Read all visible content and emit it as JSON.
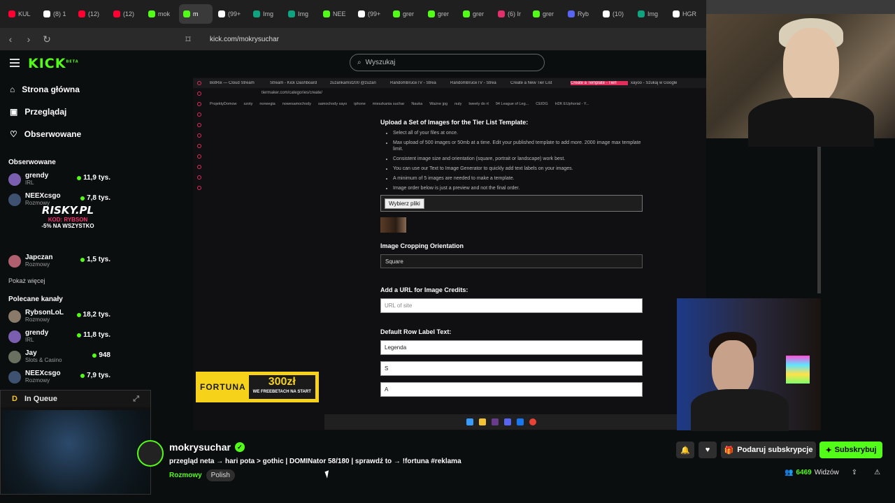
{
  "browser": {
    "tabs": [
      {
        "label": "KUL",
        "color": "#ff0033"
      },
      {
        "label": "(8) 1",
        "color": "#ffffff"
      },
      {
        "label": "(12)",
        "color": "#ff0033"
      },
      {
        "label": "(12)",
        "color": "#ff0033"
      },
      {
        "label": "mok",
        "color": "#53fc18"
      },
      {
        "label": "m",
        "color": "#53fc18",
        "active": true
      },
      {
        "label": "(99+",
        "color": "#ffffff"
      },
      {
        "label": "Img",
        "color": "#10a37f"
      },
      {
        "label": "Img",
        "color": "#10a37f"
      },
      {
        "label": "NEE",
        "color": "#53fc18"
      },
      {
        "label": "(99+",
        "color": "#ffffff"
      },
      {
        "label": "grer",
        "color": "#53fc18"
      },
      {
        "label": "grer",
        "color": "#53fc18"
      },
      {
        "label": "grer",
        "color": "#53fc18"
      },
      {
        "label": "(6) Ir",
        "color": "#e1306c"
      },
      {
        "label": "grer",
        "color": "#53fc18"
      },
      {
        "label": "Ryb",
        "color": "#5865f2"
      },
      {
        "label": "(10)",
        "color": "#ffffff"
      },
      {
        "label": "Img",
        "color": "#10a37f"
      },
      {
        "label": "HGR",
        "color": "#ffffff"
      }
    ],
    "url": "kick.com/mokrysuchar"
  },
  "header": {
    "logo": "KICK",
    "logo_beta": "BETA",
    "search_placeholder": "Wyszukaj"
  },
  "sidebar": {
    "nav": [
      {
        "label": "Strona główna",
        "icon": "home-icon"
      },
      {
        "label": "Przeglądaj",
        "icon": "browse-icon"
      },
      {
        "label": "Obserwowane",
        "icon": "heart-icon"
      }
    ],
    "following_title": "Obserwowane",
    "following": [
      {
        "name": "grendy",
        "category": "IRL",
        "viewers": "11,9 tys."
      },
      {
        "name": "NEEXcsgo",
        "category": "Rozmowy",
        "viewers": "7,8 tys."
      },
      {
        "name": "Japczan",
        "category": "Rozmowy",
        "viewers": "1,5 tys."
      }
    ],
    "show_more": "Pokaż więcej",
    "recommended_title": "Polecane kanały",
    "recommended": [
      {
        "name": "RybsonLoL",
        "category": "Rozmowy",
        "viewers": "18,2 tys."
      },
      {
        "name": "grendy",
        "category": "IRL",
        "viewers": "11,8 tys."
      },
      {
        "name": "Jay",
        "category": "Slots & Casino",
        "viewers": "948"
      },
      {
        "name": "NEEXcsgo",
        "category": "Rozmowy",
        "viewers": "7,9 tys."
      }
    ],
    "promo": {
      "brand": "RISKY.PL",
      "code": "KOD: RYBSON",
      "offer": "-5% NA WSZYSTKO"
    }
  },
  "stream": {
    "inner_tabs": [
      "BotRix — Cloud Stream",
      "Stream - Kick Dashboard",
      "zuzankamst200 @zuzan",
      "RandomBruceTV - Strea",
      "RandomBruceTV - Strea",
      "Create a New Tier List",
      "Create a Template - Tierl",
      "xayoo - Szukaj w Google"
    ],
    "inner_url": "tiermaker.com/categories/create/",
    "bookmarks": [
      "ProjektyDomow",
      "szoty",
      "norwegia",
      "nowesamochody",
      "samochody xayo",
      "iphone",
      "mieszkania suchar",
      "Nauka",
      "Ważne jpg",
      "nuty",
      "tweety do rt",
      "94 League of Leg...",
      "CEIDG",
      "H2K EUphorial - Y..."
    ],
    "upload_heading": "Upload a Set of Images for the Tier List Template:",
    "bullets": [
      "Select all of your files at once.",
      "Max upload of 500 images or 50mb at a time. Edit your published template to add more. 2000 image max template limit.",
      "Consistent image size and orientation (square, portrait or landscape) work best.",
      "You can use our Text to Image Generator to quickly add text labels on your images.",
      "A minimum of 5 images are needed to make a template.",
      "Image order below is just a preview and not the final order."
    ],
    "file_button": "Wybierz pliki",
    "crop_heading": "Image Cropping Orientation",
    "crop_value": "Square",
    "credits_heading": "Add a URL for Image Credits:",
    "credits_placeholder": "URL of site",
    "row_label_heading": "Default Row Label Text:",
    "row_labels": [
      "Legenda",
      "S",
      "A"
    ],
    "ad": {
      "brand": "FORTUNA",
      "amount": "300zł",
      "sub": "WE FREEBETACH NA START"
    }
  },
  "queue": {
    "label": "In Queue"
  },
  "channel": {
    "name": "mokrysuchar",
    "title": "przegląd neta → hari pota > gothic | DOMINator 58/180 | sprawdź to → !fortuna #reklama",
    "category": "Rozmowy",
    "tag": "Polish",
    "gift_label": "Podaruj subskrypcje",
    "subscribe_label": "Subskrybuj",
    "viewers_count": "6469",
    "viewers_label": "Widzów"
  },
  "colors": {
    "accent": "#53fc18",
    "background": "#0b0e0f"
  }
}
